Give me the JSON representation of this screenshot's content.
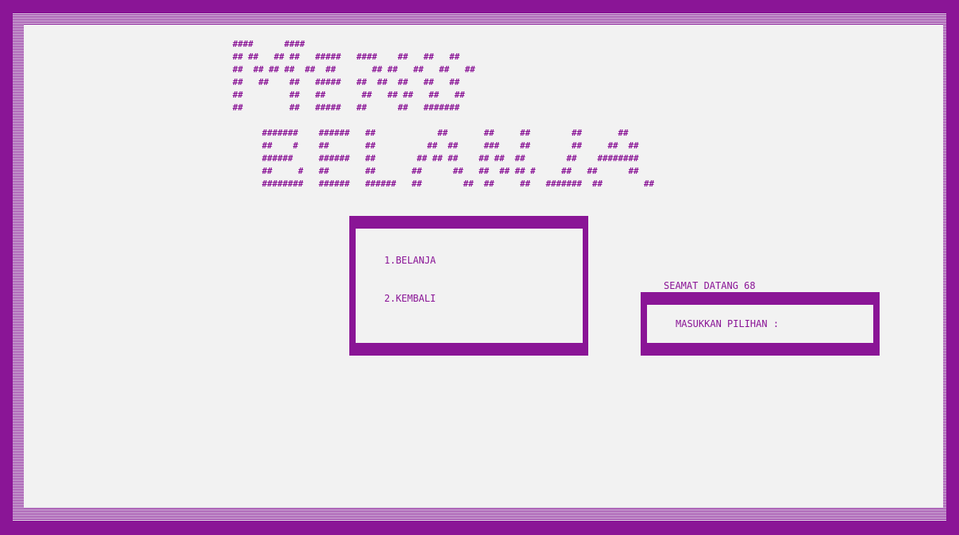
{
  "colors": {
    "accent": "#8a1596",
    "background": "#f2f2f2",
    "border_pattern": "#cfcfd6"
  },
  "banner": {
    "line1": "####      ####\n## ##   ## ##   #####   ####    ##   ##   ##\n##  ## ## ##  ##  ##       ## ##   ##   ##   ##\n##   ##    ##   #####   ##  ##  ##   ##   ##\n##         ##   ##       ##   ## ##   ##   ##\n##         ##   #####   ##      ##   #######",
    "line2": "#######    ######   ##            ##       ##     ##        ##       ##\n##    #    ##       ##          ##  ##     ###    ##        ##     ##  ##\n######     ######   ##        ## ## ##    ## ##  ##        ##    ########\n##     #   ##       ##       ##      ##   ##  ## ## #     ##   ##      ##\n########   ######   ######   ##        ##  ##     ##   #######  ##        ##"
  },
  "menu": {
    "options": [
      {
        "label": "1.BELANJA"
      },
      {
        "label": "2.KEMBALI"
      }
    ]
  },
  "greeting": "SEAMAT DATANG 68",
  "prompt": "MASUKKAN PILIHAN :"
}
